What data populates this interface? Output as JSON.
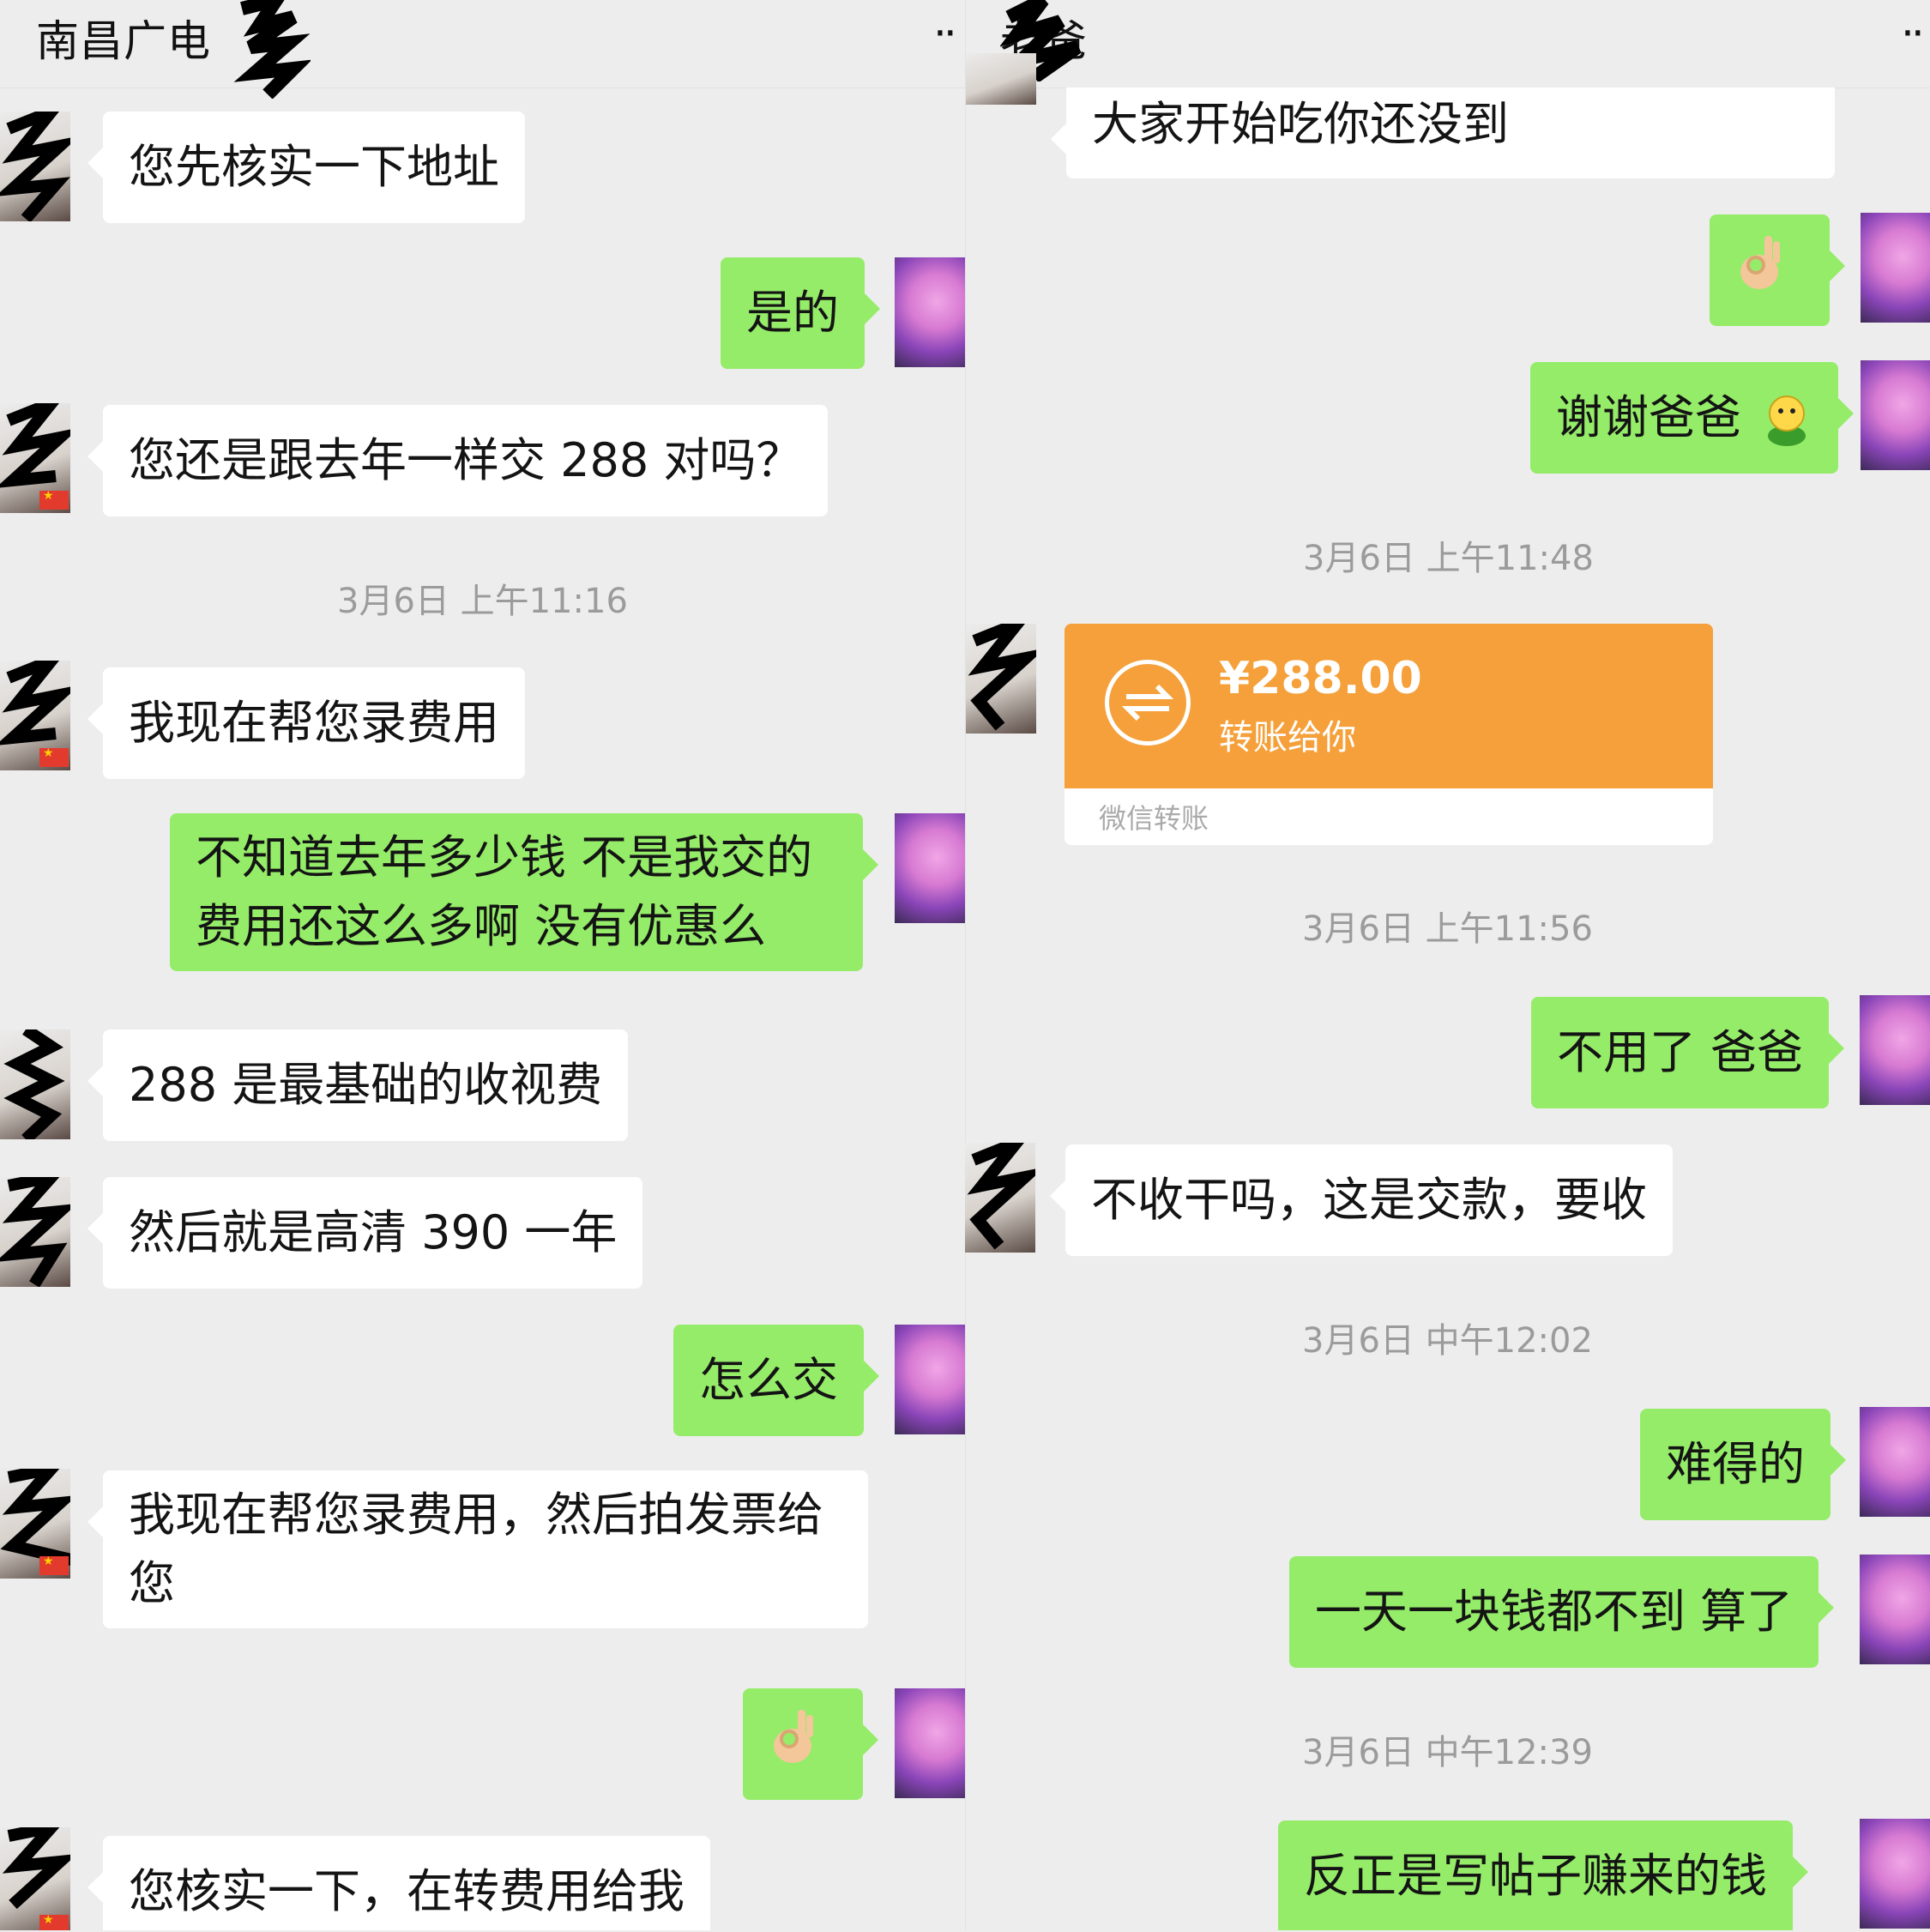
{
  "left_chat": {
    "title": "南昌广电",
    "more_icon": "more-dots-icon",
    "messages": [
      {
        "side": "in",
        "text": "您先核实一下地址"
      },
      {
        "side": "out",
        "text": "是的"
      },
      {
        "side": "in",
        "text": "您还是跟去年一样交 288 对吗？"
      },
      {
        "timestamp": "3月6日 上午11:16"
      },
      {
        "side": "in",
        "text": "我现在帮您录费用"
      },
      {
        "side": "out",
        "line1": "不知道去年多少钱  不是我交的",
        "line2": "费用还这么多啊  没有优惠么"
      },
      {
        "side": "in",
        "text": "288 是最基础的收视费"
      },
      {
        "side": "in",
        "text": "然后就是高清 390 一年"
      },
      {
        "side": "out",
        "text": "怎么交"
      },
      {
        "side": "in",
        "line1": "我现在帮您录费用，然后拍发票给",
        "line2": "您"
      },
      {
        "side": "out",
        "emoji": "ok-hand-emoji"
      },
      {
        "side": "in",
        "text": "您核实一下，在转费用给我"
      }
    ]
  },
  "right_chat": {
    "title": "老爸",
    "more_icon": "more-dots-icon",
    "messages": [
      {
        "side": "in",
        "text": "大家开始吃你还没到"
      },
      {
        "side": "out",
        "emoji": "ok-hand-emoji"
      },
      {
        "side": "out",
        "text": "谢谢爸爸",
        "emoji": "smiley-emoji"
      },
      {
        "timestamp": "3月6日 上午11:48"
      },
      {
        "side": "in",
        "transfer": {
          "amount": "¥288.00",
          "label": "转账给你",
          "brand": "微信转账"
        }
      },
      {
        "timestamp": "3月6日 上午11:56"
      },
      {
        "side": "out",
        "text": "不用了 爸爸"
      },
      {
        "side": "in",
        "text": "不收干吗，这是交款，要收"
      },
      {
        "timestamp": "3月6日 中午12:02"
      },
      {
        "side": "out",
        "text": "难得的"
      },
      {
        "side": "out",
        "text": "一天一块钱都不到 算了"
      },
      {
        "timestamp": "3月6日 中午12:39"
      },
      {
        "side": "out",
        "text": "反正是写帖子赚来的钱"
      }
    ]
  },
  "colors": {
    "background": "#ededed",
    "incoming_bubble": "#ffffff",
    "outgoing_bubble": "#95ec69",
    "transfer_card": "#f5a03a",
    "timestamp_text": "#9b9b9b"
  }
}
